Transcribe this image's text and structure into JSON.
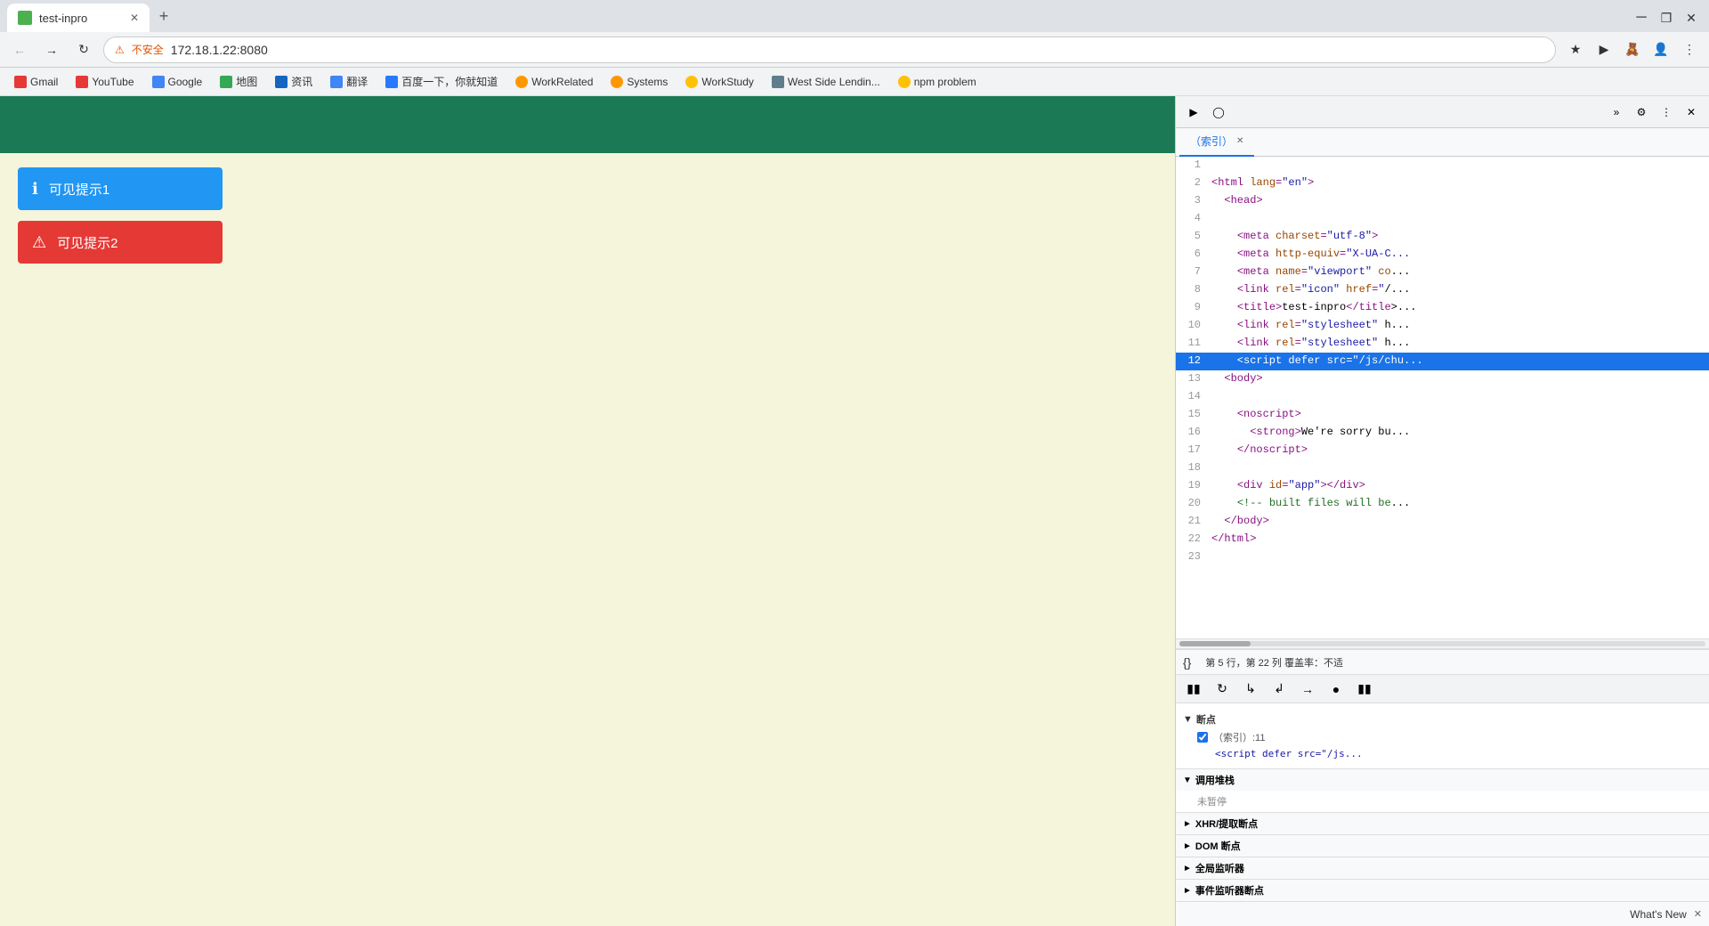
{
  "browser": {
    "tab_title": "test-inpro",
    "tab_new_label": "+",
    "address": "172.18.1.22:8080",
    "security_label": "不安全",
    "window_minimize": "─",
    "window_restore": "❐",
    "window_close": "✕"
  },
  "bookmarks": [
    {
      "id": "gmail",
      "label": "Gmail",
      "color": "#e53935"
    },
    {
      "id": "youtube",
      "label": "YouTube",
      "color": "#e53935"
    },
    {
      "id": "google",
      "label": "Google",
      "color": "#4285f4"
    },
    {
      "id": "maps",
      "label": "地图",
      "color": "#34a853"
    },
    {
      "id": "news",
      "label": "资讯",
      "color": "#1565c0"
    },
    {
      "id": "translate",
      "label": "翻译",
      "color": "#4285f4"
    },
    {
      "id": "baidu1",
      "label": "百度一下，你就知道",
      "color": "#2979ff"
    },
    {
      "id": "workrelated",
      "label": "WorkRelated",
      "color": "#ff9800"
    },
    {
      "id": "systems",
      "label": "Systems",
      "color": "#ff9800"
    },
    {
      "id": "workstudy",
      "label": "WorkStudy",
      "color": "#ffc107"
    },
    {
      "id": "westsidelending",
      "label": "West Side Lendin...",
      "color": "#607d8b"
    },
    {
      "id": "npmproblem",
      "label": "npm problem",
      "color": "#ffc107"
    }
  ],
  "alerts": [
    {
      "id": "alert1",
      "type": "info",
      "text": "可见提示1",
      "icon": "ℹ"
    },
    {
      "id": "alert2",
      "type": "warning",
      "text": "可见提示2",
      "icon": "⚠"
    }
  ],
  "devtools": {
    "tabs": [
      {
        "id": "index",
        "label": "（索引）",
        "active": true
      }
    ],
    "toolbar_icons": [
      "inspect",
      "device",
      "more-panels",
      "devtools-close"
    ],
    "status_line": "第 5 行，第 22 列  覆盖率：不适",
    "breakpoints_title": "断点",
    "breakpoint_item": {
      "checked": true,
      "label": "（索引）:11",
      "value": "<script defer src=\"/js..."
    },
    "call_stack_title": "调用堆栈",
    "call_stack_value": "未暂停",
    "xhr_title": "XHR/提取断点",
    "dom_title": "DOM 断点",
    "global_title": "全局监听器",
    "event_title": "事件监听器断点",
    "whats_new_label": "What's New",
    "code_lines": [
      {
        "num": 2,
        "content": "<html lang=\"en\">",
        "highlighted": false
      },
      {
        "num": 3,
        "content": "  <head>",
        "highlighted": false
      },
      {
        "num": 4,
        "content": "",
        "highlighted": false
      },
      {
        "num": 5,
        "content": "    <meta charset=\"utf-8\">",
        "highlighted": false
      },
      {
        "num": 6,
        "content": "    <meta http-equiv=\"X-UA-C...",
        "highlighted": false
      },
      {
        "num": 7,
        "content": "    <meta name=\"viewport\" co...",
        "highlighted": false
      },
      {
        "num": 8,
        "content": "    <link rel=\"icon\" href=\"/...",
        "highlighted": false
      },
      {
        "num": 9,
        "content": "    <title>test-inpro</title...",
        "highlighted": false
      },
      {
        "num": 10,
        "content": "    <link rel=\"stylesheet\" h...",
        "highlighted": false
      },
      {
        "num": 11,
        "content": "    <link rel=\"stylesheet\" h...",
        "highlighted": false
      },
      {
        "num": 12,
        "content": "    <script defer src=\"/js/chu...",
        "highlighted": true
      },
      {
        "num": 13,
        "content": "  <body>",
        "highlighted": false
      },
      {
        "num": 14,
        "content": "",
        "highlighted": false
      },
      {
        "num": 15,
        "content": "    <noscript>",
        "highlighted": false
      },
      {
        "num": 16,
        "content": "      <strong>We're sorry bu...",
        "highlighted": false
      },
      {
        "num": 17,
        "content": "    </noscript>",
        "highlighted": false
      },
      {
        "num": 18,
        "content": "",
        "highlighted": false
      },
      {
        "num": 19,
        "content": "    <div id=\"app\"></div>",
        "highlighted": false
      },
      {
        "num": 20,
        "content": "    <!-- built files will be...",
        "highlighted": false
      },
      {
        "num": 21,
        "content": "  </body>",
        "highlighted": false
      },
      {
        "num": 22,
        "content": "</html>",
        "highlighted": false
      },
      {
        "num": 23,
        "content": "",
        "highlighted": false
      }
    ]
  }
}
